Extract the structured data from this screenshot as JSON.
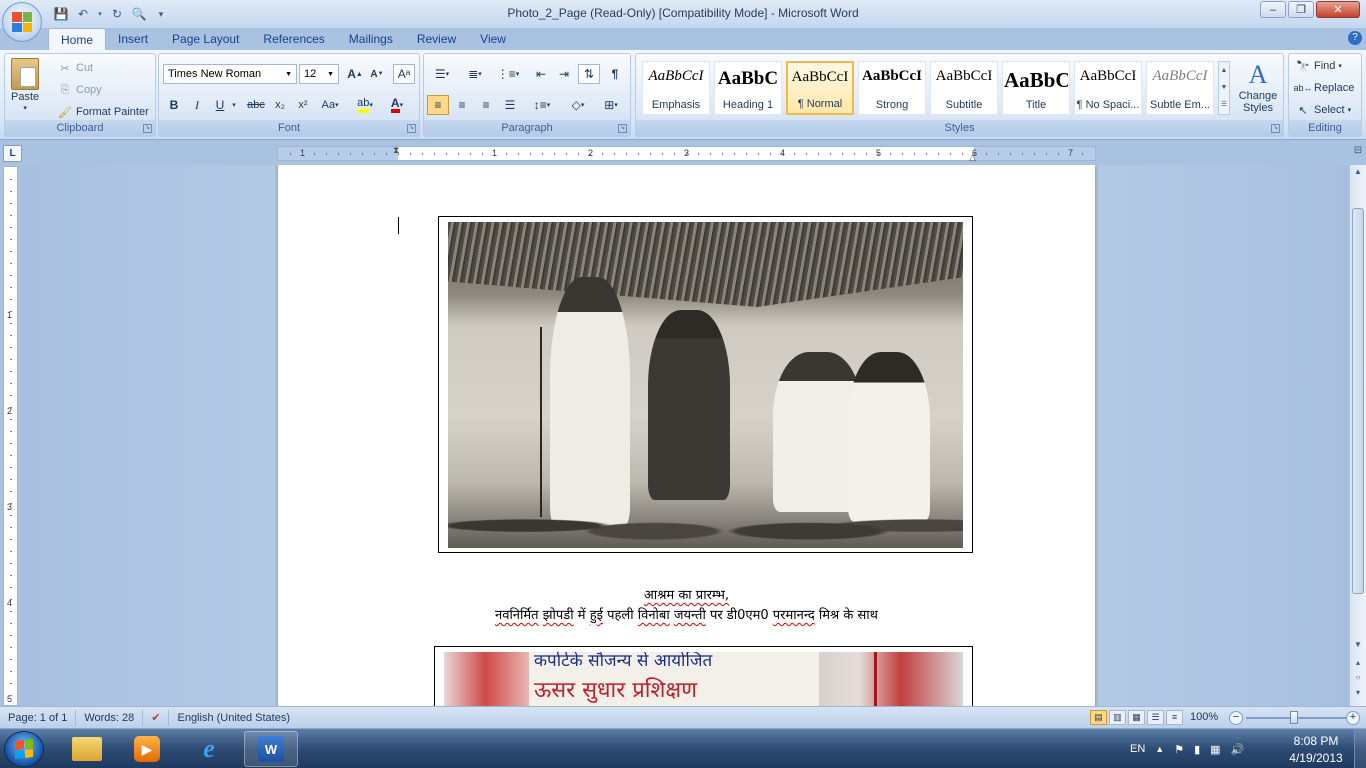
{
  "window": {
    "title": "Photo_2_Page (Read-Only) [Compatibility Mode] - Microsoft Word",
    "minimize": "–",
    "maximize": "❐",
    "close": "✕"
  },
  "tabs": [
    {
      "label": "Home",
      "active": true
    },
    {
      "label": "Insert"
    },
    {
      "label": "Page Layout"
    },
    {
      "label": "References"
    },
    {
      "label": "Mailings"
    },
    {
      "label": "Review"
    },
    {
      "label": "View"
    }
  ],
  "clipboard": {
    "paste": "Paste",
    "cut": "Cut",
    "copy": "Copy",
    "format_painter": "Format Painter",
    "group": "Clipboard"
  },
  "font": {
    "name": "Times New Roman",
    "size": "12",
    "group": "Font",
    "grow": "A",
    "shrink": "A",
    "bold": "B",
    "italic": "I",
    "underline": "U",
    "strike": "abc",
    "sub": "x₂",
    "sup": "x²",
    "case": "Aa"
  },
  "paragraph": {
    "group": "Paragraph"
  },
  "styles": {
    "group": "Styles",
    "items": [
      {
        "preview": "AaBbCcI",
        "name": "Emphasis"
      },
      {
        "preview": "AaBbC",
        "name": "Heading 1"
      },
      {
        "preview": "AaBbCcI",
        "name": "¶ Normal"
      },
      {
        "preview": "AaBbCcI",
        "name": "Strong"
      },
      {
        "preview": "AaBbCcI",
        "name": "Subtitle"
      },
      {
        "preview": "AaBbC",
        "name": "Title"
      },
      {
        "preview": "AaBbCcI",
        "name": "¶ No Spaci..."
      },
      {
        "preview": "AaBbCcI",
        "name": "Subtle Em..."
      }
    ],
    "change_styles": "Change Styles"
  },
  "editing": {
    "group": "Editing",
    "find": "Find",
    "replace": "Replace",
    "select": "Select"
  },
  "ruler": {
    "tab_selector": "L",
    "h_numbers": [
      "1",
      "1",
      "2",
      "3",
      "4",
      "5",
      "6",
      "7"
    ],
    "v_numbers": [
      "1",
      "2",
      "3",
      "4",
      "5"
    ]
  },
  "document": {
    "caption_line1": "आश्रम का प्रारम्भ,",
    "caption_line2_words": [
      "नवनिर्मित",
      "झोपडी",
      "में",
      "हुई",
      "पहली",
      "विनोबा",
      "जयन्ती",
      "पर",
      "डी0एम0",
      "परमानन्द",
      "मिश्र",
      "के",
      "साथ"
    ],
    "photo2_banner_line1": "कर्पार्टके सौजन्य से आयोजित",
    "photo2_banner_line2": "ऊसर सुधार प्रशिक्षण"
  },
  "status": {
    "page": "Page: 1 of 1",
    "words": "Words: 28",
    "language": "English (United States)",
    "zoom": "100%"
  },
  "taskbar": {
    "lang": "EN",
    "time": "8:08 PM",
    "date": "4/19/2013"
  }
}
